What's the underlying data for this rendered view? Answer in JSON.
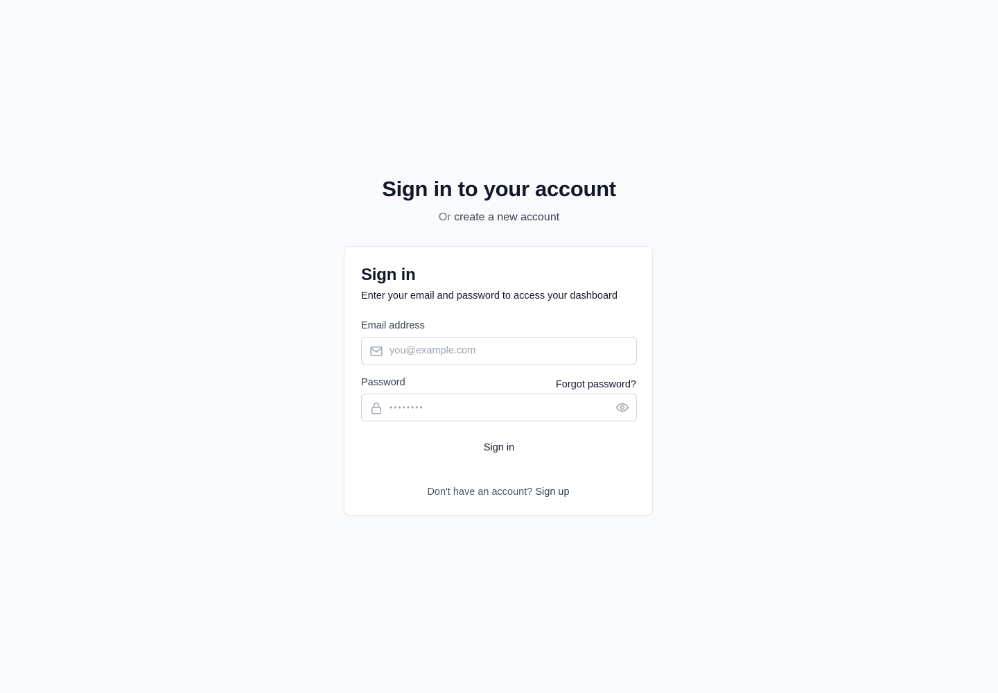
{
  "header": {
    "title": "Sign in to your account",
    "subtitle_prefix": "Or ",
    "subtitle_link": "create a new account"
  },
  "card": {
    "title": "Sign in",
    "description": "Enter your email and password to access your dashboard",
    "email": {
      "label": "Email address",
      "placeholder": "you@example.com",
      "value": "",
      "icon": "mail-icon"
    },
    "password": {
      "label": "Password",
      "placeholder": "••••••••",
      "value": "",
      "icon": "lock-icon",
      "toggle_icon": "eye-icon"
    },
    "forgot_link": "Forgot password?",
    "submit_label": "Sign in",
    "footer_prefix": "Don't have an account? ",
    "footer_link": "Sign up"
  },
  "colors": {
    "background": "#f8fafc",
    "card": "#ffffff",
    "border": "#d1d5db",
    "text_primary": "#111827",
    "text_muted": "#6b7280",
    "icon": "#9ca3af"
  }
}
